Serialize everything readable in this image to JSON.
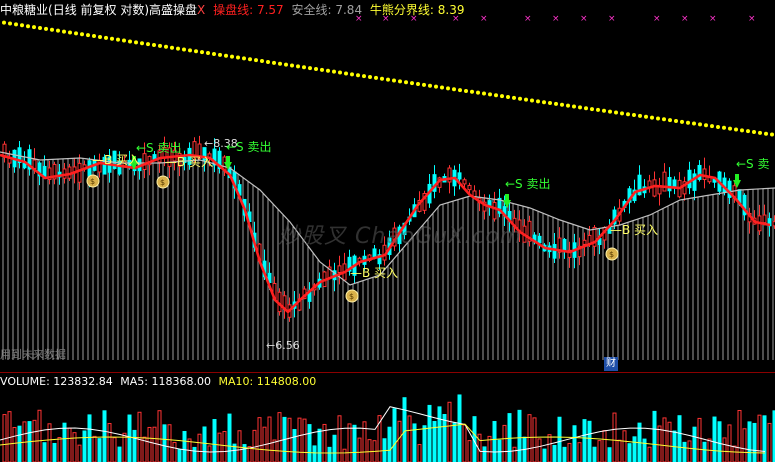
{
  "header": {
    "stock_name": "中粮糖业",
    "period": "(日线 前复权 对数)",
    "indicator": "高盛操盘",
    "close_symbol": "X",
    "line1_label": "操盘线: ",
    "line1_value": "7.57",
    "line2_label": "安全线: ",
    "line2_value": "7.84",
    "line3_label": "牛熊分界线: ",
    "line3_value": "8.39"
  },
  "volume_header": {
    "volume_label": "VOLUME: ",
    "volume_value": "123832.84",
    "ma5_label": "MA5: ",
    "ma5_value": "118368.00",
    "ma10_label": "MA10: ",
    "ma10_value": "114808.00"
  },
  "annotations": {
    "high_marker": "8.38",
    "low_marker": "6.56",
    "sell_1": "←S 卖出",
    "buy_1": "B 买入",
    "buy_2": "B 买入",
    "sell_2": "←S 卖出",
    "buy_3": "B 买入",
    "sell_3": "←S 卖出",
    "buy_4": "B 买入",
    "sell_4": "←S 卖"
  },
  "watermark": "炒股叉 ChaoGuX.com",
  "bottom_note": "用到未来数据",
  "cai_badge": "财",
  "colors": {
    "up": "#ff3333",
    "down": "#00ffff",
    "cao_pan_line": "#ff2020",
    "safe_line": "#c0c0c0",
    "bull_bear_line": "#ffff00",
    "sell_text": "#33ff33",
    "buy_text": "#ffff66"
  },
  "chart_data": [
    {
      "type": "candlestick",
      "title": "中粮糖业 (日线 前复权 对数) 高盛操盘",
      "series": [
        {
          "name": "操盘线",
          "last": 7.57
        },
        {
          "name": "安全线",
          "last": 7.84
        },
        {
          "name": "牛熊分界线",
          "last": 8.39
        }
      ],
      "markers": {
        "high": 8.38,
        "low": 6.56
      },
      "signals": [
        "←S 卖出",
        "B 买入",
        "B 买入",
        "←S 卖出",
        "B 买入",
        "←S 卖出",
        "B 买入",
        "←S 卖"
      ]
    },
    {
      "type": "bar",
      "title": "VOLUME",
      "series": [
        {
          "name": "VOLUME",
          "last": 123832.84
        },
        {
          "name": "MA5",
          "last": 118368.0
        },
        {
          "name": "MA10",
          "last": 114808.0
        }
      ]
    }
  ]
}
